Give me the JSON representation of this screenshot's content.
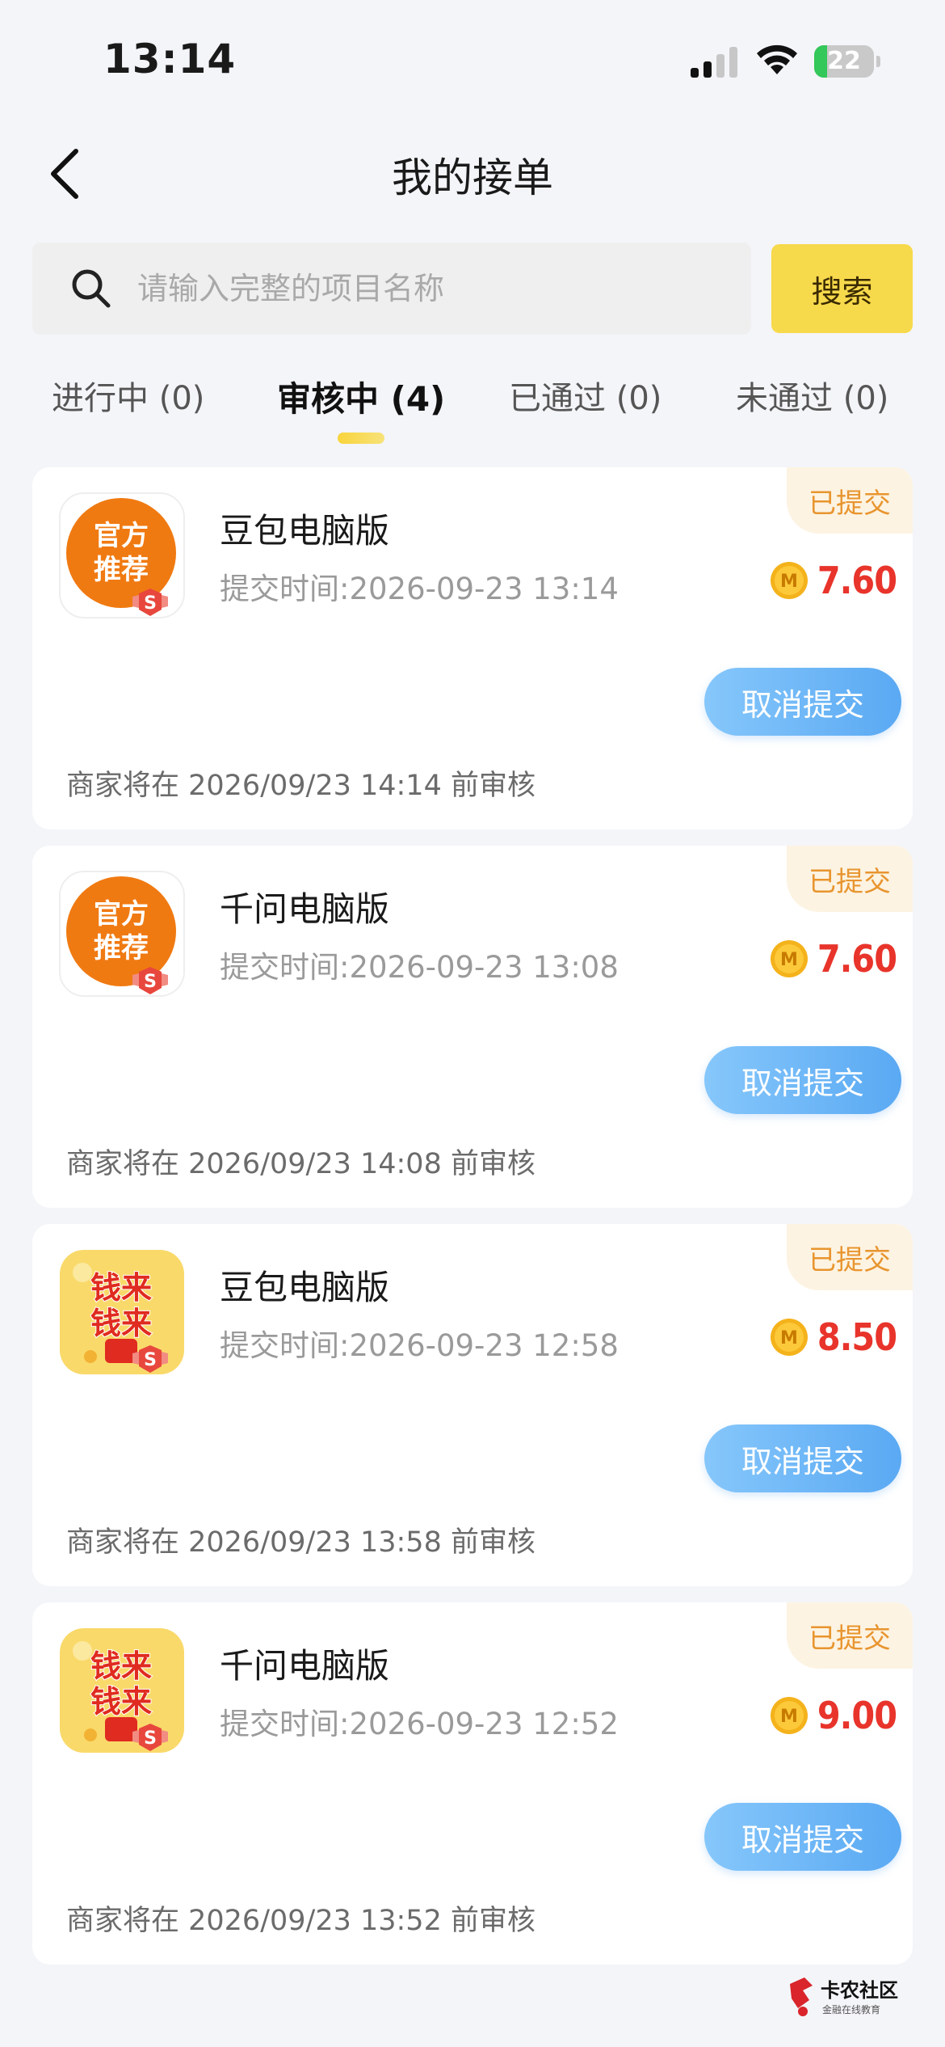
{
  "status_bar": {
    "time": "13:14",
    "battery": "22",
    "battery_level": 0.22
  },
  "header": {
    "title": "我的接单"
  },
  "search": {
    "placeholder": "请输入完整的项目名称",
    "value": "",
    "button_label": "搜索"
  },
  "tabs": [
    {
      "label": "进行中 (0)",
      "active": false
    },
    {
      "label": "审核中 (4)",
      "active": true
    },
    {
      "label": "已通过 (0)",
      "active": false
    },
    {
      "label": "未通过 (0)",
      "active": false
    }
  ],
  "orders": [
    {
      "thumb": "official-recommend-icon",
      "thumb_text_1": "官方",
      "thumb_text_2": "推荐",
      "status": "已提交",
      "title": "豆包电脑版",
      "submit_time": "提交时间:2026-09-23 13:14",
      "reward": "7.60",
      "cancel_label": "取消提交",
      "review_note": "商家将在 2026/09/23 14:14 前审核"
    },
    {
      "thumb": "official-recommend-icon",
      "thumb_text_1": "官方",
      "thumb_text_2": "推荐",
      "status": "已提交",
      "title": "千问电脑版",
      "submit_time": "提交时间:2026-09-23 13:08",
      "reward": "7.60",
      "cancel_label": "取消提交",
      "review_note": "商家将在 2026/09/23 14:08 前审核"
    },
    {
      "thumb": "money-coming-icon",
      "thumb_text_1": "钱来",
      "thumb_text_2": "钱来",
      "status": "已提交",
      "title": "豆包电脑版",
      "submit_time": "提交时间:2026-09-23 12:58",
      "reward": "8.50",
      "cancel_label": "取消提交",
      "review_note": "商家将在 2026/09/23 13:58 前审核"
    },
    {
      "thumb": "money-coming-icon",
      "thumb_text_1": "钱来",
      "thumb_text_2": "钱来",
      "status": "已提交",
      "title": "千问电脑版",
      "submit_time": "提交时间:2026-09-23 12:52",
      "reward": "9.00",
      "cancel_label": "取消提交",
      "review_note": "商家将在 2026/09/23 13:52 前审核"
    }
  ],
  "badge_letter": "S",
  "coin_letter": "M",
  "watermark": {
    "name": "卡农社区",
    "sub": "金融在线教育"
  },
  "colors": {
    "accent_yellow": "#f7d94c",
    "reward_red": "#e8342b",
    "button_blue": "#5aa9f3",
    "tag_orange": "#e8952f"
  }
}
